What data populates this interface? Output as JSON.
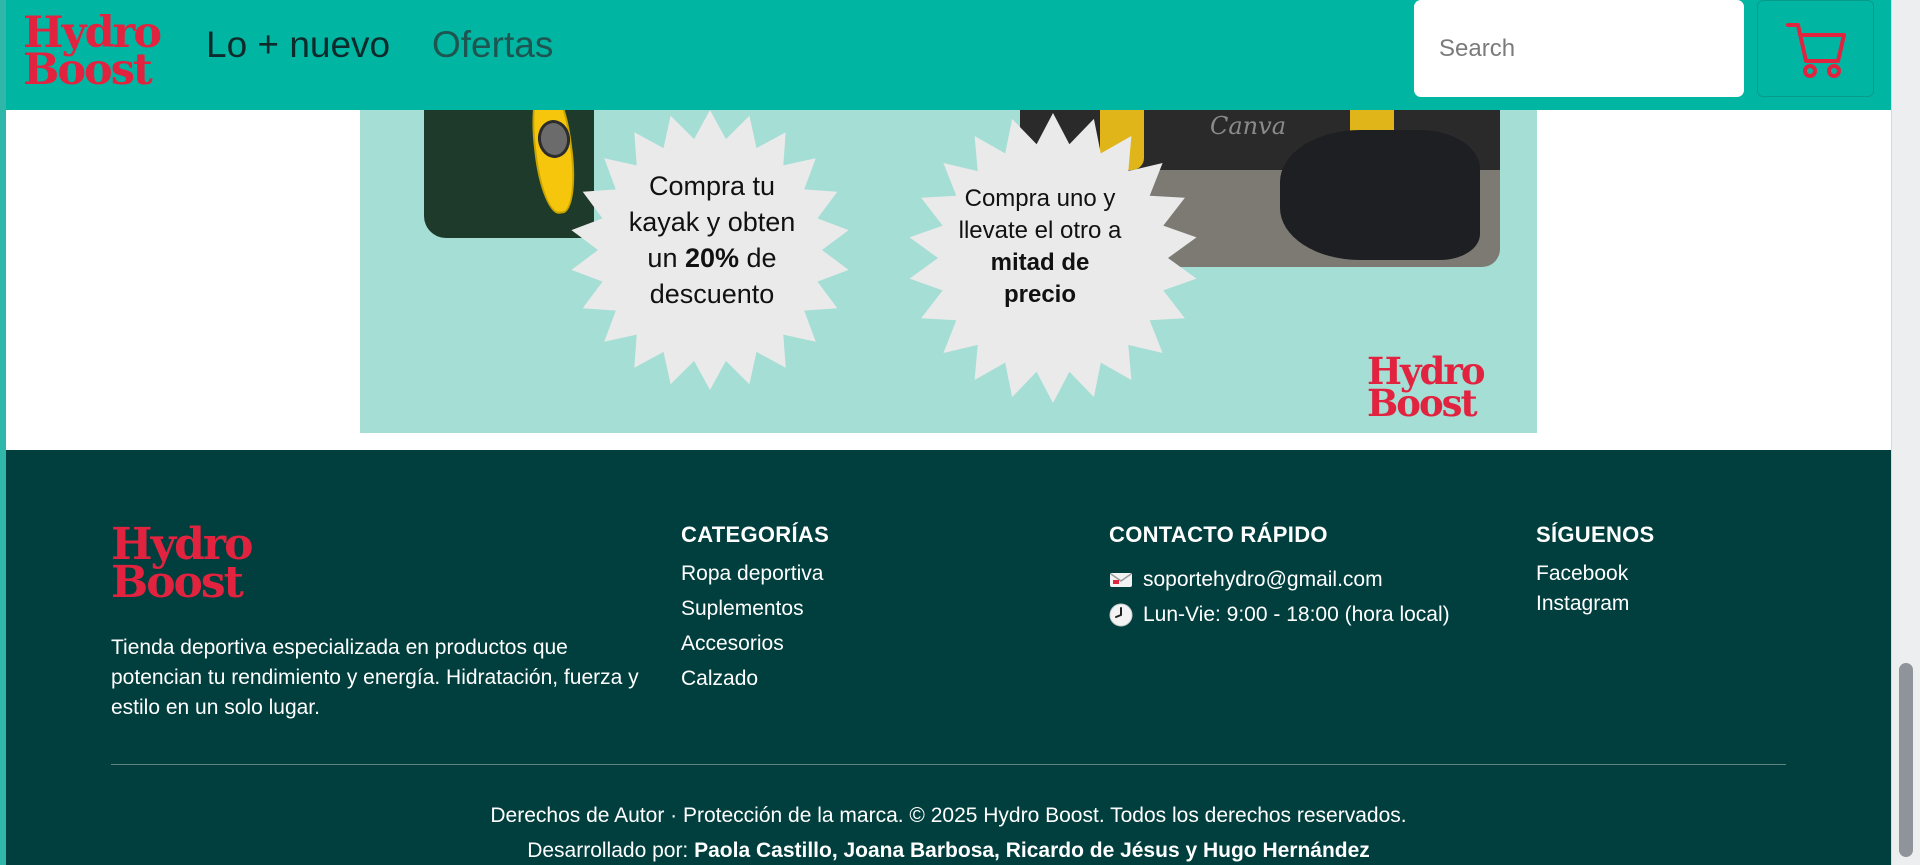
{
  "brand": {
    "name_line1": "Hydro",
    "name_line2": "Boost",
    "color": "#e2233f"
  },
  "header": {
    "background": "#00b6a3",
    "nav": [
      {
        "label": "Lo + nuevo"
      },
      {
        "label": "Ofertas"
      }
    ],
    "search": {
      "placeholder": "Search",
      "value": ""
    },
    "cart_icon": "shopping-cart-icon"
  },
  "banner": {
    "background": "#a4ded5",
    "promo1": {
      "line1": "Compra tu",
      "line2": "kayak y obten",
      "pre": "un ",
      "bold": "20%",
      "post": " de",
      "line4": "descuento"
    },
    "promo2": {
      "line1": "Compra uno y",
      "line2": "llevate el otro a",
      "bold1": "mitad de",
      "bold2": "precio"
    },
    "photo_watermark": "Canva"
  },
  "footer": {
    "background": "#003f3d",
    "description": "Tienda deportiva especializada en productos que potencian tu rendimiento y energía. Hidratación, fuerza y estilo en un solo lugar.",
    "categories": {
      "title": "CATEGORÍAS",
      "items": [
        "Ropa deportiva",
        "Suplementos",
        "Accesorios",
        "Calzado"
      ]
    },
    "contact": {
      "title": "CONTACTO RÁPIDO",
      "email": "soportehydro@gmail.com",
      "hours": "Lun-Vie: 9:00 - 18:00 (hora local)",
      "email_icon": "envelope-icon",
      "hours_icon": "clock-icon"
    },
    "social": {
      "title": "SÍGUENOS",
      "items": [
        "Facebook",
        "Instagram"
      ]
    },
    "copyright": "Derechos de Autor · Protección de la marca. © 2025 Hydro Boost. Todos los derechos reservados.",
    "developed_by_label": "Desarrollado por: ",
    "developers": "Paola Castillo, Joana Barbosa, Ricardo de Jésus y Hugo Hernández"
  }
}
